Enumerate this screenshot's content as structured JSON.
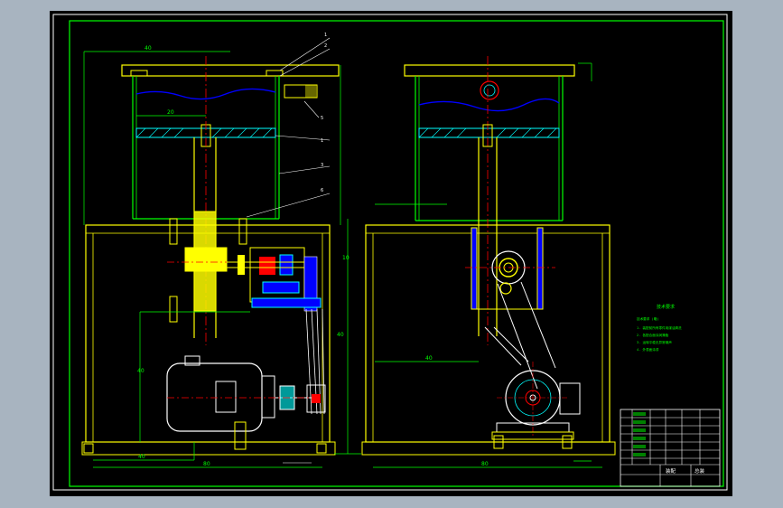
{
  "sheet": {
    "background": "#000000",
    "viewport_bg": "#a8b4c0",
    "colors": {
      "outline": "#ffff00",
      "frame": "#00ff00",
      "dimension": "#00ff00",
      "center": "#ff0000",
      "fluid": "#0000ff",
      "hatch": "#00ffff",
      "parts_blue": "#0000ff",
      "parts_yellow": "#ffff00",
      "parts_red": "#ff0000",
      "leader": "#ffffff",
      "tech_text": "#00ff00"
    }
  },
  "left_view": {
    "dims": {
      "top_width": "40",
      "tank_inner": "20",
      "base_total": "80",
      "base_half": "40",
      "height_right": "10",
      "height_left": "40",
      "side_label": "40"
    },
    "part_balloons": [
      "1",
      "2",
      "5",
      "1",
      "3",
      "6"
    ]
  },
  "right_view": {
    "dims": {
      "base_total": "80",
      "side": "40"
    }
  },
  "technical": {
    "title": "技术要求",
    "lines": [
      "技术要求 (略)",
      "1. 装配前所有零件用煤油清洗",
      "2. 各配合面涂润滑脂",
      "3. 运转平稳无异常噪声",
      "4. 外表面涂漆"
    ]
  },
  "title_block": {
    "name": "装配",
    "drawing_no": "总装"
  }
}
